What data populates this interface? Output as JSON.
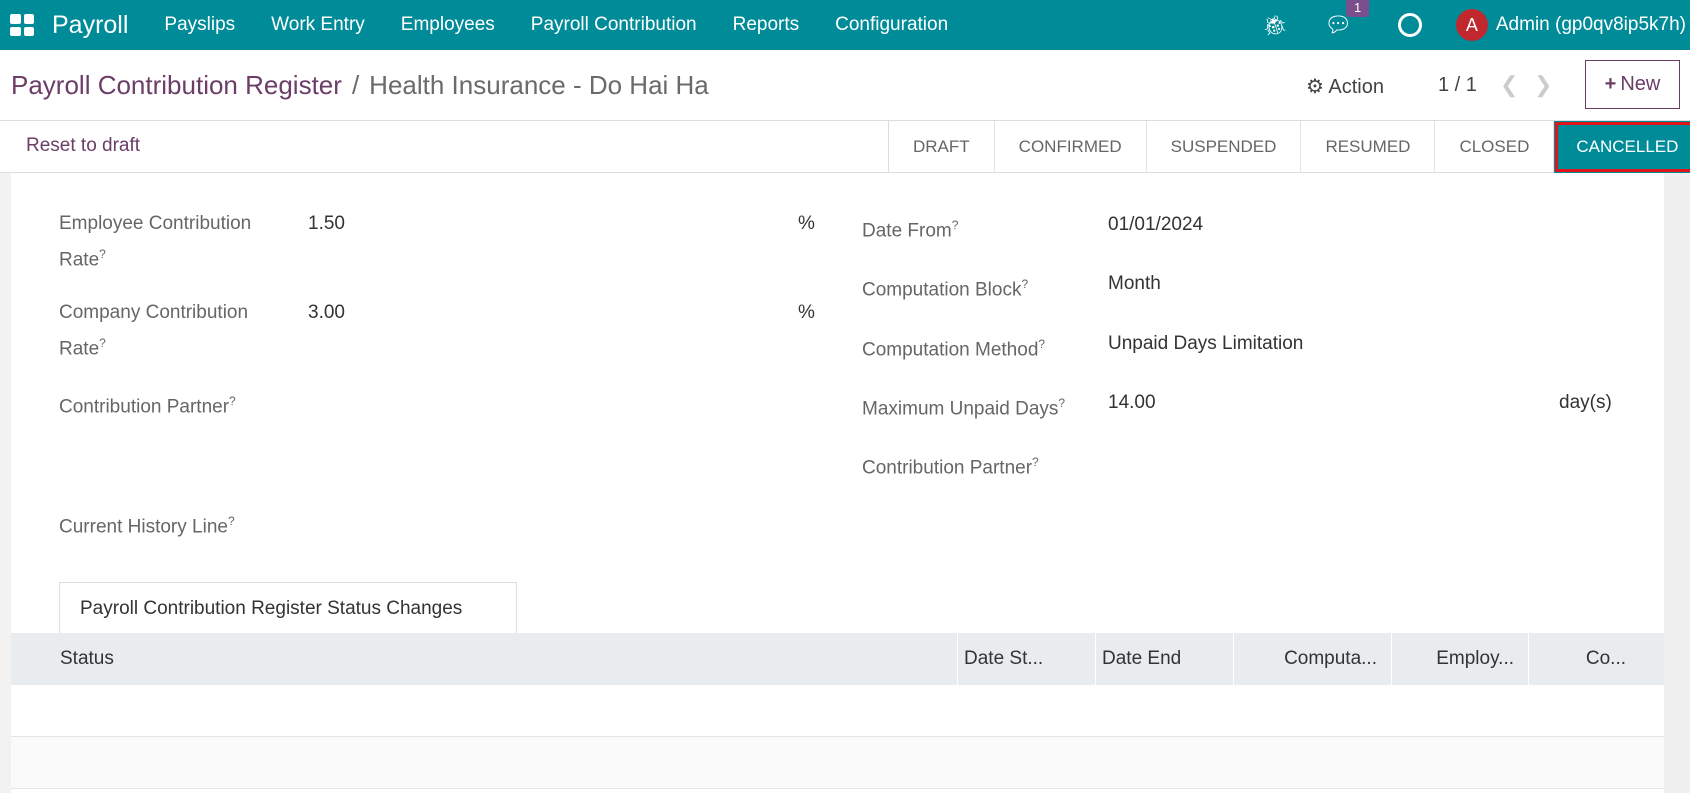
{
  "nav": {
    "brand": "Payroll",
    "menu": [
      "Payslips",
      "Work Entry",
      "Employees",
      "Payroll Contribution",
      "Reports",
      "Configuration"
    ],
    "message_count": "1",
    "avatar_letter": "A",
    "user": "Admin (gp0qv8ip5k7h)"
  },
  "breadcrumb": {
    "parent": "Payroll Contribution Register",
    "separator": "/",
    "current": "Health Insurance - Do Hai Ha"
  },
  "control": {
    "action": "Action",
    "pager": "1 / 1",
    "new": "New"
  },
  "statusbar": {
    "reset": "Reset to draft",
    "steps": [
      "DRAFT",
      "CONFIRMED",
      "SUSPENDED",
      "RESUMED",
      "CLOSED",
      "CANCELLED"
    ],
    "active": "CANCELLED"
  },
  "form": {
    "left": [
      {
        "label": "Employee Contribution Rate",
        "value": "1.50",
        "unit": "%"
      },
      {
        "label": "Company Contribution Rate",
        "value": "3.00",
        "unit": "%"
      },
      {
        "label": "Contribution Partner",
        "value": ""
      },
      {
        "label": "Current History Line",
        "value": ""
      }
    ],
    "right": [
      {
        "label": "Date From",
        "value": "01/01/2024"
      },
      {
        "label": "Computation Block",
        "value": "Month"
      },
      {
        "label": "Computation Method",
        "value": "Unpaid Days Limitation"
      },
      {
        "label": "Maximum Unpaid Days",
        "value": "14.00",
        "unit": "day(s)"
      },
      {
        "label": "Contribution Partner",
        "value": ""
      }
    ]
  },
  "tab": "Payroll Contribution Register Status Changes",
  "table": {
    "columns": [
      "Status",
      "Date St...",
      "Date End",
      "Computa...",
      "Employ...",
      "Co..."
    ]
  }
}
